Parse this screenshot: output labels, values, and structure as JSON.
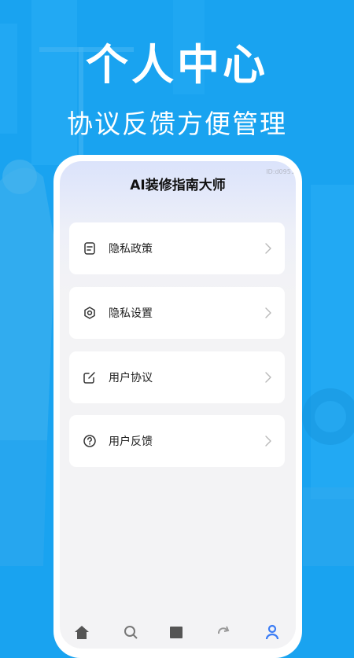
{
  "promo": {
    "headline": "个人中心",
    "subline": "协议反馈方便管理"
  },
  "app": {
    "title": "AI装修指南大师",
    "id_label": "ID:d09514"
  },
  "menu": {
    "items": [
      {
        "label": "隐私政策",
        "icon": "document-icon"
      },
      {
        "label": "隐私设置",
        "icon": "settings-icon"
      },
      {
        "label": "用户协议",
        "icon": "edit-icon"
      },
      {
        "label": "用户反馈",
        "icon": "help-icon"
      }
    ]
  },
  "tabbar": {
    "tabs": [
      "home-icon",
      "search-icon",
      "square-icon",
      "rotate-icon",
      "profile-icon"
    ],
    "active_color": "#3b7cf5"
  },
  "colors": {
    "background": "#19a3f0",
    "card": "#ffffff"
  }
}
